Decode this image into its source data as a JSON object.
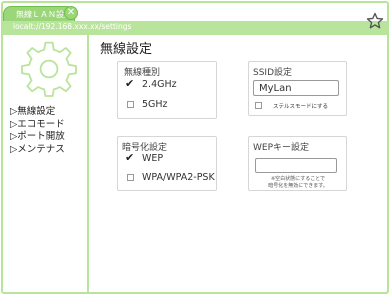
{
  "browser": {
    "tab_title": "無線ＬＡＮ設定",
    "tab_close": "✕",
    "url": "localt://192.168.xxx.xx/settings"
  },
  "sidebar": {
    "items": [
      {
        "label": "▷無線設定"
      },
      {
        "label": "▷エコモード"
      },
      {
        "label": "▷ポート開放"
      },
      {
        "label": "▷メンテナス"
      }
    ]
  },
  "main": {
    "title": "無線設定",
    "band": {
      "title": "無線種別",
      "options": [
        {
          "label": "2.4GHz",
          "checked": true
        },
        {
          "label": "5GHz",
          "checked": false
        }
      ]
    },
    "ssid": {
      "title": "SSID設定",
      "value": "MyLan",
      "stealth_label": "ステルスモードにする",
      "stealth_checked": false
    },
    "encryption": {
      "title": "暗号化設定",
      "options": [
        {
          "label": "WEP",
          "checked": true
        },
        {
          "label": "WPA/WPA2-PSK",
          "checked": false
        }
      ]
    },
    "wep_key": {
      "title": "WEPキー設定",
      "value": "",
      "note_line1": "※空白状態にすることで",
      "note_line2": "暗号化を無効にできます。"
    }
  },
  "colors": {
    "accent": "#9bd67a",
    "accent_border": "#6fbf4b",
    "frame": "#b8e39a"
  }
}
